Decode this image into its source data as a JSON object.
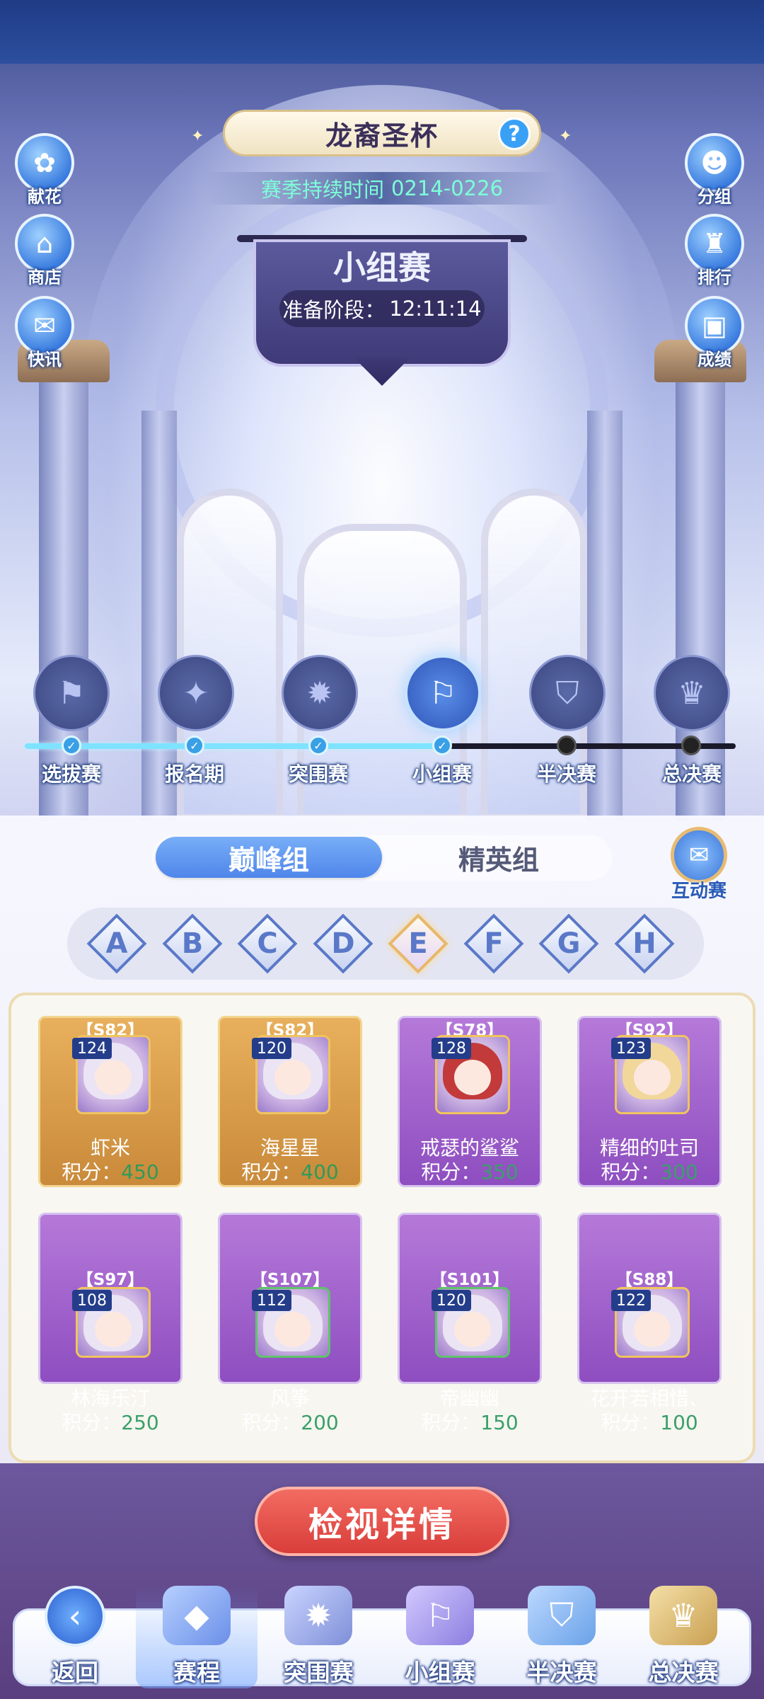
{
  "header": {
    "title": "龙裔圣杯",
    "season_label": "赛季持续时间",
    "season_dates": "0214-0226"
  },
  "left_buttons": [
    {
      "label": "献花",
      "icon": "rose-icon"
    },
    {
      "label": "商店",
      "icon": "shop-icon"
    },
    {
      "label": "快讯",
      "icon": "news-scroll-icon"
    }
  ],
  "right_buttons": [
    {
      "label": "分组",
      "icon": "group-icon"
    },
    {
      "label": "排行",
      "icon": "castle-icon"
    },
    {
      "label": "成绩",
      "icon": "cards-icon"
    }
  ],
  "stage": {
    "name": "小组赛",
    "phase_label": "准备阶段：",
    "timer": "12:11:14"
  },
  "timeline": {
    "stages": [
      {
        "label": "选拔赛",
        "status": "done",
        "icon": "flag-icon"
      },
      {
        "label": "报名期",
        "status": "done",
        "icon": "book-icon"
      },
      {
        "label": "突围赛",
        "status": "done",
        "icon": "sun-scroll-icon"
      },
      {
        "label": "小组赛",
        "status": "current",
        "icon": "banner-icon"
      },
      {
        "label": "半决赛",
        "status": "todo",
        "icon": "shield-icon"
      },
      {
        "label": "总决赛",
        "status": "todo",
        "icon": "trophy-icon"
      }
    ]
  },
  "group_tabs": {
    "active": "巅峰组",
    "inactive": "精英组"
  },
  "interact_button": {
    "label": "互动赛"
  },
  "groups": {
    "letters": [
      "A",
      "B",
      "C",
      "D",
      "E",
      "F",
      "G",
      "H"
    ],
    "selected": "E"
  },
  "score_prefix": "积分：",
  "players": [
    {
      "server": "【S82】",
      "level": "124",
      "name": "虾米",
      "score": "450",
      "style": "gold"
    },
    {
      "server": "【S82】",
      "level": "120",
      "name": "海星星",
      "score": "400",
      "style": "gold"
    },
    {
      "server": "【S78】",
      "level": "128",
      "name": "戒瑟的鲨鲨",
      "score": "350",
      "style": "purple"
    },
    {
      "server": "【S92】",
      "level": "123",
      "name": "精细的吐司",
      "score": "300",
      "style": "purple"
    },
    {
      "server": "【S97】",
      "level": "108",
      "name": "林海乐汀",
      "score": "250",
      "style": "purple"
    },
    {
      "server": "【S107】",
      "level": "112",
      "name": "风筝",
      "score": "200",
      "style": "purple"
    },
    {
      "server": "【S101】",
      "level": "120",
      "name": "帝幽幽",
      "score": "150",
      "style": "purple"
    },
    {
      "server": "【S88】",
      "level": "122",
      "name": "花开若相惜、",
      "score": "100",
      "style": "purple"
    }
  ],
  "inspect_button": "检视详情",
  "bottom_nav": [
    {
      "label": "返回",
      "icon": "back-icon"
    },
    {
      "label": "赛程",
      "icon": "crystal-sword-icon",
      "active": true
    },
    {
      "label": "突围赛",
      "icon": "sun-scroll-icon"
    },
    {
      "label": "小组赛",
      "icon": "banner-icon"
    },
    {
      "label": "半决赛",
      "icon": "shield-icon"
    },
    {
      "label": "总决赛",
      "icon": "trophy-icon"
    }
  ],
  "colors": {
    "accent_blue": "#4f86ea",
    "score_green": "#3aa06a",
    "inspect_red": "#d93d3a",
    "card_gold": "#e8b05d",
    "card_purple": "#b579d9"
  }
}
